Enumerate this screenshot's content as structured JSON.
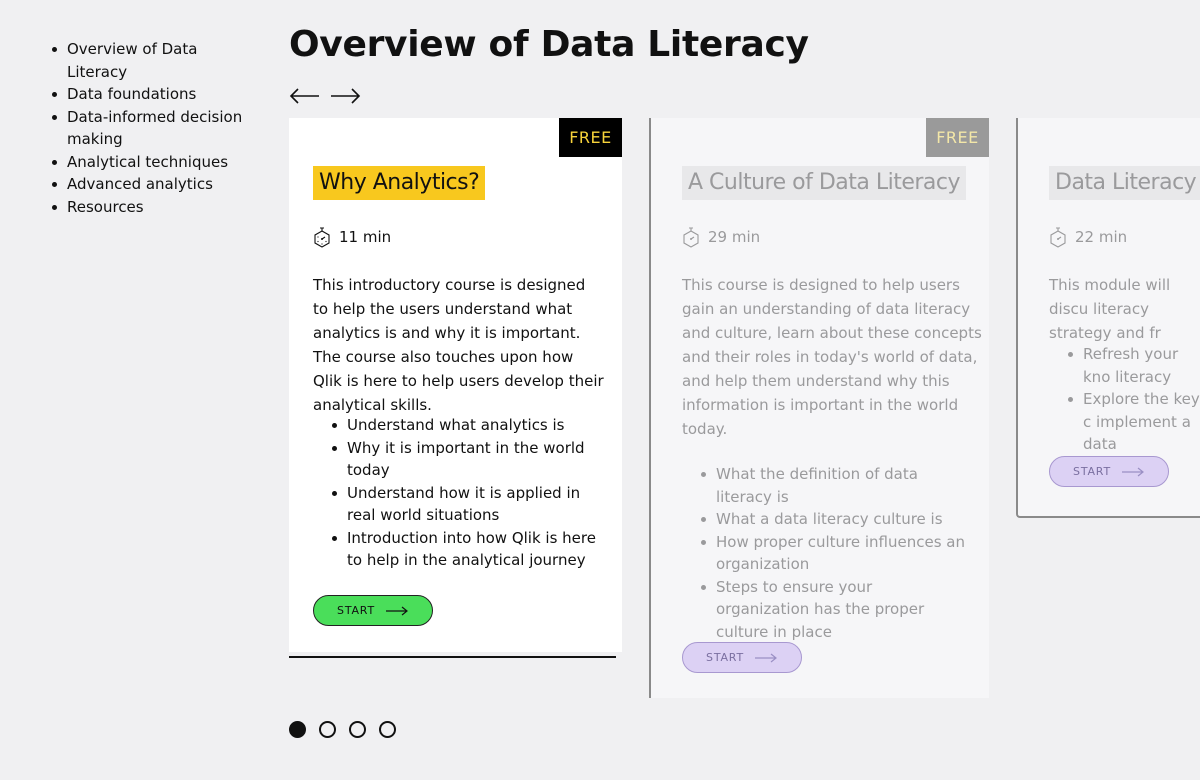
{
  "sidebar": {
    "items": [
      {
        "label": "Overview of Data Literacy"
      },
      {
        "label": "Data foundations"
      },
      {
        "label": "Data-informed decision making"
      },
      {
        "label": "Analytical techniques"
      },
      {
        "label": "Advanced analytics"
      },
      {
        "label": "Resources"
      }
    ]
  },
  "page": {
    "title": "Overview of Data Literacy",
    "prev_icon": "arrow-left-icon",
    "next_icon": "arrow-right-icon"
  },
  "cards": [
    {
      "badge": "FREE",
      "title": "Why Analytics?",
      "duration": "11 min",
      "description": "This introductory course is designed to help the users understand what analytics is and why it is important. The course also touches upon how Qlik is here to help users develop their analytical skills.",
      "bullets": [
        "Understand what analytics is",
        "Why it is important in the world today",
        "Understand how it is applied in real world situations",
        "Introduction into how Qlik is here to help in the analytical journey"
      ],
      "button": "START"
    },
    {
      "badge": "FREE",
      "title": "A Culture of Data Literacy",
      "duration": "29 min",
      "description": "This course is designed to help users gain an understanding of data literacy and culture, learn about these concepts and their roles in today's world of data, and help them understand why this information is important in the world today.",
      "bullets": [
        "What the definition of data literacy is",
        "What a data literacy culture is",
        "How proper culture influences an organization",
        "Steps to ensure your organization has the proper culture in place"
      ],
      "button": "START"
    },
    {
      "title": "Data Literacy Ac",
      "duration": "22 min",
      "description": "This module will discu literacy strategy and fr",
      "bullets": [
        "Refresh your kno literacy",
        "Explore the key c implement a data"
      ],
      "button": "START"
    }
  ],
  "pagination": {
    "count": 4,
    "active": 1
  },
  "colors": {
    "badge_bg": "#000000",
    "badge_text": "#f7d33a",
    "title_highlight": "#f8c81e",
    "start_button": "#4ade5a",
    "start_button_faded": "#dcd1f4",
    "background": "#f0f0f2"
  }
}
